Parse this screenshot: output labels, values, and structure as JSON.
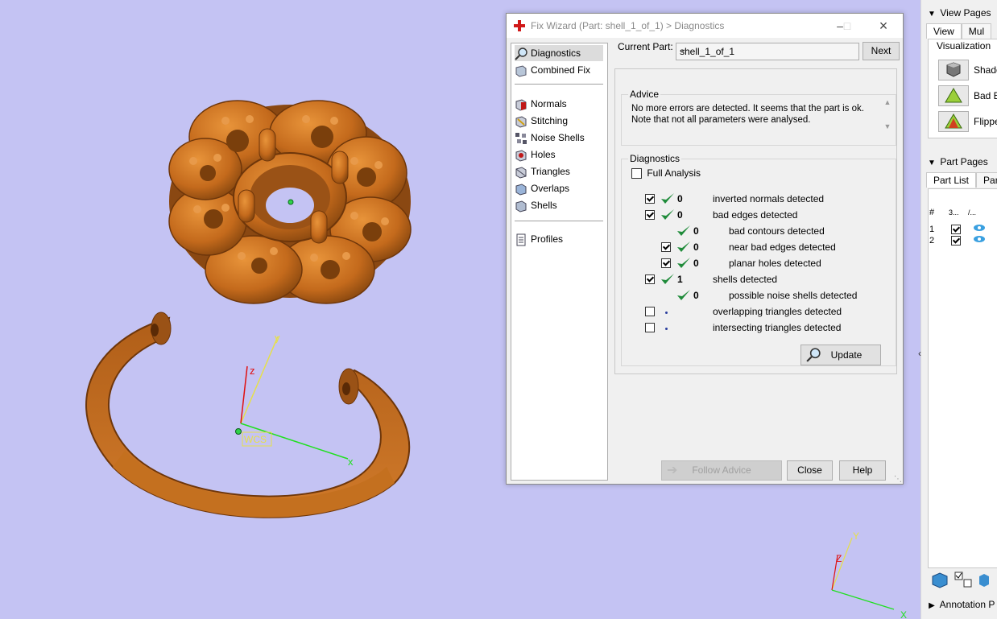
{
  "dialog": {
    "title": "Fix Wizard (Part: shell_1_of_1) > Diagnostics",
    "nav": [
      {
        "label": "Diagnostics",
        "icon": "magnifier-icon"
      },
      {
        "label": "Combined Fix",
        "icon": "combined-fix-icon"
      },
      {
        "label": "Normals",
        "icon": "normals-icon"
      },
      {
        "label": "Stitching",
        "icon": "stitching-icon"
      },
      {
        "label": "Noise Shells",
        "icon": "noise-shells-icon"
      },
      {
        "label": "Holes",
        "icon": "holes-icon"
      },
      {
        "label": "Triangles",
        "icon": "triangles-icon"
      },
      {
        "label": "Overlaps",
        "icon": "overlaps-icon"
      },
      {
        "label": "Shells",
        "icon": "shells-icon"
      },
      {
        "label": "Profiles",
        "icon": "profiles-icon"
      }
    ],
    "current_part_label": "Current Part:",
    "current_part_value": "shell_1_of_1",
    "next_label": "Next",
    "advice_title": "Advice",
    "advice_line1": "No more errors are detected. It seems that the part is ok.",
    "advice_line2": "Note that not all parameters were analysed.",
    "diagnostics_title": "Diagnostics",
    "full_analysis_label": "Full Analysis",
    "rows": [
      {
        "count": "0",
        "label": "inverted normals detected",
        "checkbox": true,
        "checked": true,
        "status": "ok"
      },
      {
        "count": "0",
        "label": "bad edges detected",
        "checkbox": true,
        "checked": true,
        "status": "ok"
      },
      {
        "count": "0",
        "label": "bad contours detected",
        "checkbox": false,
        "checked": false,
        "status": "ok"
      },
      {
        "count": "0",
        "label": "near bad edges detected",
        "checkbox": true,
        "checked": true,
        "status": "ok"
      },
      {
        "count": "0",
        "label": "planar holes detected",
        "checkbox": true,
        "checked": true,
        "status": "ok"
      },
      {
        "count": "1",
        "label": "shells detected",
        "checkbox": true,
        "checked": true,
        "status": "ok"
      },
      {
        "count": "0",
        "label": "possible noise shells detected",
        "checkbox": false,
        "checked": false,
        "status": "ok"
      },
      {
        "count": "",
        "label": "overlapping triangles detected",
        "checkbox": true,
        "checked": false,
        "status": "pending"
      },
      {
        "count": "",
        "label": "intersecting triangles detected",
        "checkbox": true,
        "checked": false,
        "status": "pending"
      }
    ],
    "update_label": "Update",
    "follow_advice_label": "Follow Advice",
    "close_label": "Close",
    "help_label": "Help"
  },
  "right_panel": {
    "view_pages_label": "View Pages",
    "tabs_view": [
      "View",
      "Mul"
    ],
    "visualization_label": "Visualization",
    "vis_items": [
      "Shade",
      "Bad Ec",
      "Flipped"
    ],
    "part_pages_label": "Part Pages",
    "tabs_part": [
      "Part List",
      "Par"
    ],
    "part_list_headers": [
      "#",
      "3...",
      "/..."
    ],
    "part_list_rows": [
      {
        "num": "1",
        "checked": true
      },
      {
        "num": "2",
        "checked": true
      }
    ],
    "annotation_label": "Annotation P"
  },
  "viewport": {
    "wcs_label": "WCS",
    "axis_x": "x",
    "axis_y": "y",
    "axis_z": "z",
    "mini_axis_x": "X",
    "mini_axis_y": "Y",
    "mini_axis_z": "Z"
  },
  "colors": {
    "viewport_bg": "#c4c3f3",
    "model_orange": "#c46a1c",
    "check_green": "#1f8b3a"
  }
}
